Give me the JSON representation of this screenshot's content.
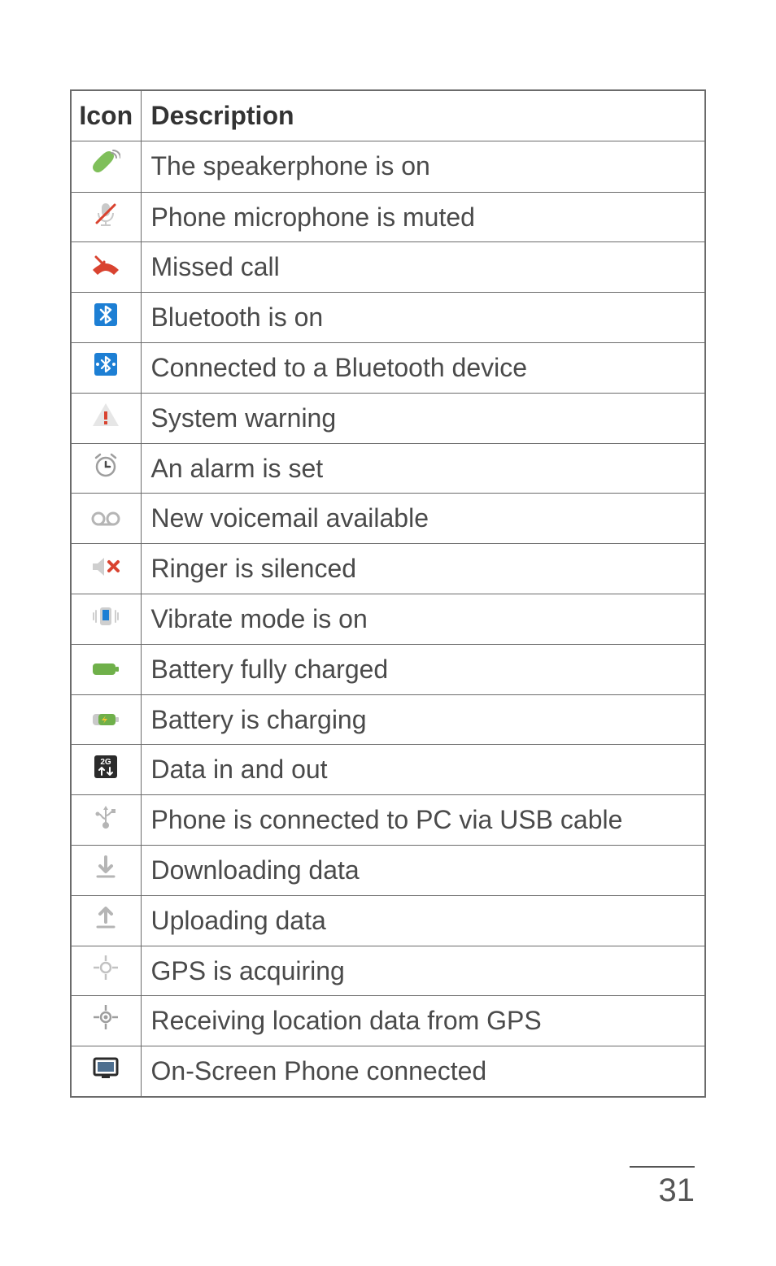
{
  "table": {
    "headers": {
      "icon": "Icon",
      "desc": "Description"
    },
    "rows": [
      {
        "icon_name": "speakerphone-icon",
        "desc": "The speakerphone is on"
      },
      {
        "icon_name": "mic-muted-icon",
        "desc": "Phone microphone is muted"
      },
      {
        "icon_name": "missed-call-icon",
        "desc": "Missed call"
      },
      {
        "icon_name": "bluetooth-on-icon",
        "desc": "Bluetooth is on"
      },
      {
        "icon_name": "bluetooth-connected-icon",
        "desc": "Connected to a Bluetooth device"
      },
      {
        "icon_name": "system-warning-icon",
        "desc": "System warning"
      },
      {
        "icon_name": "alarm-set-icon",
        "desc": "An alarm is set"
      },
      {
        "icon_name": "voicemail-icon",
        "desc": "New voicemail available"
      },
      {
        "icon_name": "ringer-silenced-icon",
        "desc": "Ringer is silenced"
      },
      {
        "icon_name": "vibrate-mode-icon",
        "desc": "Vibrate mode is on"
      },
      {
        "icon_name": "battery-full-icon",
        "desc": "Battery fully charged"
      },
      {
        "icon_name": "battery-charging-icon",
        "desc": "Battery is charging"
      },
      {
        "icon_name": "data-in-out-icon",
        "desc": "Data in and out"
      },
      {
        "icon_name": "usb-connected-icon",
        "desc": "Phone is connected to PC via USB cable"
      },
      {
        "icon_name": "downloading-icon",
        "desc": "Downloading data"
      },
      {
        "icon_name": "uploading-icon",
        "desc": "Uploading data"
      },
      {
        "icon_name": "gps-acquiring-icon",
        "desc": "GPS is acquiring"
      },
      {
        "icon_name": "gps-receiving-icon",
        "desc": "Receiving location data from GPS"
      },
      {
        "icon_name": "on-screen-phone-icon",
        "desc": "On-Screen Phone connected"
      }
    ]
  },
  "page_number": "31"
}
